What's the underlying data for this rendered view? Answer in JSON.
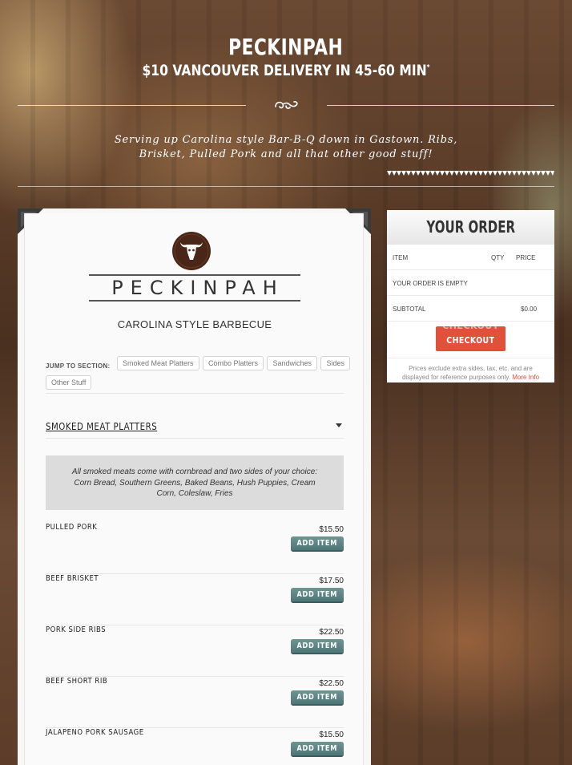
{
  "header": {
    "title": "PECKINPAH",
    "tagline": "$10 VANCOUVER DELIVERY IN 45-60 MIN",
    "tagline_mark": "*",
    "intro_line1": "Serving up Carolina style Bar-B-Q down in Gastown. Ribs,",
    "intro_line2": "Brisket, Pulled Pork and all that other good stuff!"
  },
  "menu": {
    "logo_text": "PECKINPAH",
    "subtitle": "CAROLINA STYLE BARBECUE",
    "jump_label": "JUMP TO SECTION:",
    "jump_links": [
      "Smoked Meat Platters",
      "Combo Platters",
      "Sandwiches",
      "Sides",
      "Other Stuff"
    ],
    "section_title": "SMOKED MEAT PLATTERS",
    "notice": "All smoked meats come with cornbread and two sides of your choice: Corn Bread, Southern Greens, Baked Beans, Hush Puppies, Cream Corn, Coleslaw, Fries",
    "add_label": "ADD ITEM",
    "items": [
      {
        "name": "PULLED PORK",
        "price": "$15.50"
      },
      {
        "name": "BEEF BRISKET",
        "price": "$17.50"
      },
      {
        "name": "PORK SIDE RIBS",
        "price": "$22.50"
      },
      {
        "name": "BEEF SHORT RIB",
        "price": "$22.50"
      },
      {
        "name": "JALAPENO PORK SAUSAGE",
        "price": "$15.50"
      }
    ]
  },
  "order": {
    "title": "YOUR ORDER",
    "col_item": "ITEM",
    "col_qty": "QTY",
    "col_price": "PRICE",
    "empty_text": "YOUR ORDER IS EMPTY",
    "subtotal_label": "SUBTOTAL",
    "subtotal_value": "$0.00",
    "checkout_label": "CHECKOUT",
    "note": "Prices exclude extra sides, tax, etc. and are displayed for reference purposes only.",
    "note_link": "More Info"
  },
  "colors": {
    "accent": "#e0503b",
    "button_teal": "#5a8282",
    "logo_brown": "#4a2618"
  }
}
